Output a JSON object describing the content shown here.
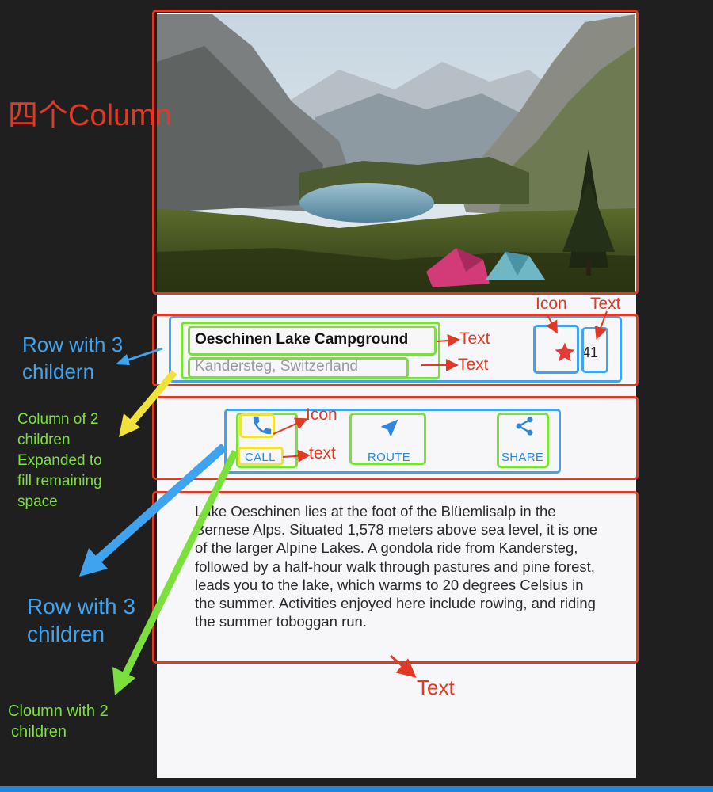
{
  "app": {
    "title": "Oeschinen Lake Campground",
    "subtitle": "Kandersteg, Switzerland",
    "favorite_count": "41",
    "buttons": [
      {
        "label": "CALL",
        "icon": "phone-icon"
      },
      {
        "label": "ROUTE",
        "icon": "navigation-arrow-icon"
      },
      {
        "label": "SHARE",
        "icon": "share-icon"
      }
    ],
    "description": "Lake Oeschinen lies at the foot of the Blüemlisalp in the Bernese Alps. Situated 1,578 meters above sea level, it is one of the larger Alpine Lakes. A gondola ride from Kandersteg, followed by a half-hour walk through pastures and pine forest, leads you to the lake, which warms to 20 degrees Celsius in the summer. Activities enjoyed here include rowing, and riding the summer toboggan run."
  },
  "annotations": {
    "four_columns": "四个Column",
    "row_with_3_children_top": [
      "Row with 3",
      "childern"
    ],
    "column_of_2_children": [
      "Column of 2",
      "children",
      "Expanded to",
      "fill remaining",
      "space"
    ],
    "row_with_3_children_bottom": [
      "Row with 3",
      "children"
    ],
    "column_with_2_children": [
      "Cloumn with 2",
      "children"
    ],
    "icon_star": "Icon",
    "text_count": "Text",
    "text_title": "Text",
    "text_subtitle": "Text",
    "icon_call": "Icon",
    "text_call": "text",
    "text_paragraph": "Text"
  },
  "colors": {
    "accent_blue": "#2e86de",
    "star_red": "#e53935",
    "annotation_red": "#e03a26",
    "annotation_blue": "#3fa3f0",
    "annotation_green": "#7ce03c",
    "annotation_yellow": "#f1e23a"
  }
}
